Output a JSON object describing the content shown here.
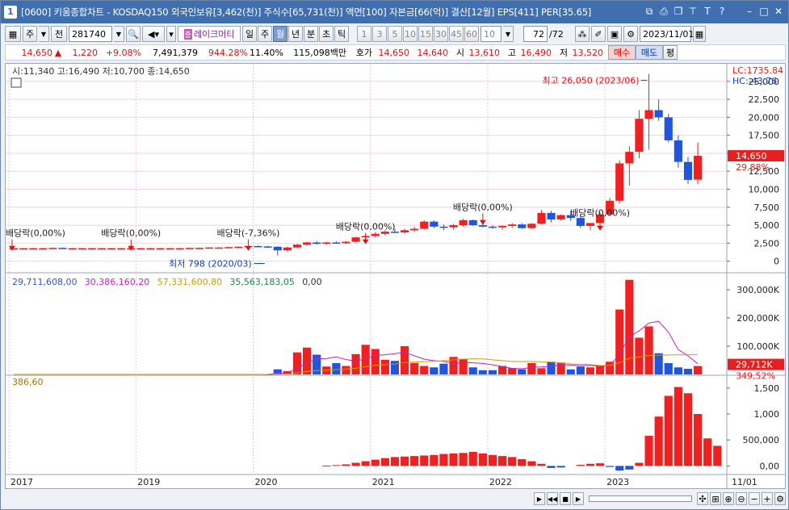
{
  "window": {
    "number": "1",
    "title": "[0600] 키움종합차트 - KOSDAQ150 외국인보유[3,462(천)] 주식수[65,731(천)] 액면[100] 자본금[66(억)] 결산[12월] EPS[411] PER[35.65]"
  },
  "toolbar": {
    "type_select": "주",
    "prefix_btn": "전",
    "code": "281740",
    "name": "레이크머티",
    "period": [
      "일",
      "주",
      "월",
      "년",
      "분",
      "초",
      "틱"
    ],
    "period_selected": "월",
    "intervals": [
      "1",
      "3",
      "5",
      "10",
      "15",
      "30",
      "45",
      "60"
    ],
    "interval_value": "10",
    "count": "72",
    "count_total": "/72",
    "date": "2023/11/01"
  },
  "quote": {
    "price": "14,650",
    "arrow": "▲",
    "change": "1,220",
    "rate": "+9.08%",
    "volume": "7,491,379",
    "vol_ratio": "944.28%",
    "turnover": "11.40%",
    "amount": "115,098백만",
    "ask_label": "호가",
    "ask": "14,650",
    "bid": "14,640",
    "open_label": "시",
    "open": "13,610",
    "high_label": "고",
    "high": "16,490",
    "low_label": "저",
    "low": "13,520",
    "buy_btn": "매수",
    "sell_btn": "매도",
    "avg_btn": "평"
  },
  "chart_data": [
    {
      "type": "candlestick",
      "panel": "price",
      "legend": "시:11,340 고:16,490 저:10,700 종:14,650",
      "y_ticks": [
        "0",
        "2,500",
        "5,000",
        "7,500",
        "10,000",
        "12,500",
        "15,000",
        "17,500",
        "20,000",
        "22,500",
        "25,000"
      ],
      "ylim": [
        -1500,
        27000
      ],
      "lc_label": "LC:1735.84",
      "hc_label": "HC:-43.76",
      "price_tag": "14,650",
      "pct_tag": "29.88%",
      "annotations": [
        {
          "text": "배당락(0,00%)",
          "month": 1,
          "price": 1900,
          "side": "left"
        },
        {
          "text": "배당락(0,00%)",
          "month": 13,
          "price": 1900
        },
        {
          "text": "배당락(-7,36%)",
          "month": 25,
          "price": 1900
        },
        {
          "text": "배당락(0,00%)",
          "month": 37,
          "price": 2800
        },
        {
          "text": "배당락(0,00%)",
          "month": 49,
          "price": 5500
        },
        {
          "text": "배당락(0,00%)",
          "month": 61,
          "price": 4700
        },
        {
          "text": "최고 26,050 (2023/06)",
          "month": 66,
          "price": 26050,
          "kind": "high"
        },
        {
          "text": "최저 798 (2020/03)",
          "month": 27,
          "price": 798,
          "kind": "low"
        }
      ],
      "candles": [
        [
          1800,
          1800,
          1800,
          1800
        ],
        [
          1800,
          1850,
          1750,
          1800
        ],
        [
          1800,
          1850,
          1750,
          1800
        ],
        [
          1800,
          1850,
          1750,
          1800
        ],
        [
          1800,
          1900,
          1750,
          1850
        ],
        [
          1850,
          1900,
          1800,
          1800
        ],
        [
          1800,
          1850,
          1750,
          1800
        ],
        [
          1800,
          1850,
          1750,
          1800
        ],
        [
          1800,
          1850,
          1750,
          1800
        ],
        [
          1800,
          1850,
          1750,
          1800
        ],
        [
          1800,
          1850,
          1750,
          1800
        ],
        [
          1800,
          1850,
          1750,
          1800
        ],
        [
          1800,
          1850,
          1750,
          1800
        ],
        [
          1800,
          1850,
          1750,
          1800
        ],
        [
          1800,
          1850,
          1750,
          1800
        ],
        [
          1800,
          1850,
          1750,
          1800
        ],
        [
          1800,
          1850,
          1750,
          1800
        ],
        [
          1800,
          1850,
          1750,
          1800
        ],
        [
          1800,
          1900,
          1750,
          1850
        ],
        [
          1850,
          1900,
          1800,
          1850
        ],
        [
          1850,
          1950,
          1800,
          1900
        ],
        [
          1900,
          1950,
          1850,
          1900
        ],
        [
          1900,
          2000,
          1850,
          1950
        ],
        [
          1950,
          2050,
          1900,
          2000
        ],
        [
          2000,
          2150,
          1950,
          2100
        ],
        [
          2100,
          2200,
          2000,
          2050
        ],
        [
          2050,
          2150,
          1900,
          2000
        ],
        [
          2000,
          2050,
          798,
          1500
        ],
        [
          1500,
          2000,
          1350,
          1900
        ],
        [
          1900,
          2400,
          1850,
          2300
        ],
        [
          2300,
          2700,
          2200,
          2600
        ],
        [
          2600,
          2800,
          2300,
          2400
        ],
        [
          2400,
          2700,
          2300,
          2600
        ],
        [
          2600,
          2750,
          2400,
          2500
        ],
        [
          2500,
          2800,
          2400,
          2700
        ],
        [
          2700,
          3400,
          2600,
          3300
        ],
        [
          3300,
          3700,
          3100,
          3500
        ],
        [
          3500,
          4000,
          3300,
          3800
        ],
        [
          3800,
          4300,
          3600,
          4100
        ],
        [
          4100,
          4500,
          3900,
          4000
        ],
        [
          4000,
          4500,
          3800,
          4300
        ],
        [
          4300,
          4800,
          4100,
          4500
        ],
        [
          4500,
          5700,
          4400,
          5500
        ],
        [
          5500,
          5700,
          4600,
          4800
        ],
        [
          4800,
          5100,
          4300,
          4700
        ],
        [
          4700,
          5200,
          4400,
          5000
        ],
        [
          5000,
          5900,
          4800,
          5700
        ],
        [
          5700,
          5800,
          4900,
          5000
        ],
        [
          5000,
          5200,
          4700,
          4800
        ],
        [
          4800,
          5000,
          4500,
          4700
        ],
        [
          4700,
          5000,
          4400,
          4900
        ],
        [
          4900,
          5300,
          4600,
          5100
        ],
        [
          5100,
          5300,
          4500,
          4600
        ],
        [
          4600,
          5300,
          4500,
          5200
        ],
        [
          5200,
          7100,
          5100,
          6700
        ],
        [
          6700,
          7000,
          5400,
          5800
        ],
        [
          5800,
          6500,
          5600,
          6400
        ],
        [
          6400,
          7000,
          5600,
          6000
        ],
        [
          6000,
          6300,
          4600,
          4900
        ],
        [
          4900,
          5300,
          4300,
          5300
        ],
        [
          5300,
          6800,
          5200,
          6500
        ],
        [
          6500,
          8800,
          6300,
          8400
        ],
        [
          8400,
          14000,
          8000,
          13600
        ],
        [
          13600,
          16000,
          10500,
          15200
        ],
        [
          15200,
          21000,
          14300,
          19800
        ],
        [
          19800,
          26050,
          15500,
          21000
        ],
        [
          21000,
          22500,
          19500,
          20000
        ],
        [
          20000,
          20500,
          16500,
          16800
        ],
        [
          16800,
          17500,
          13000,
          13800
        ],
        [
          13800,
          14500,
          10700,
          11300
        ],
        [
          11340,
          16490,
          10700,
          14650
        ]
      ],
      "axis_labels": [
        {
          "month": 0,
          "text": "2017"
        },
        {
          "month": 13,
          "text": "2019"
        },
        {
          "month": 25,
          "text": "2020"
        },
        {
          "month": 37,
          "text": "2021"
        },
        {
          "month": 49,
          "text": "2022"
        },
        {
          "month": 61,
          "text": "2023"
        },
        {
          "month": 75,
          "text": "11/01"
        }
      ]
    },
    {
      "type": "bar",
      "panel": "volume",
      "legend": [
        "29,711,608,00",
        "30,386,160,20",
        "57,331,600,80",
        "35,563,183,05",
        "0,00"
      ],
      "legend_colors": [
        "#3355cc",
        "#cc22cc",
        "#d49b00",
        "#1a8a3a",
        "#333333"
      ],
      "y_ticks": [
        "100,000K",
        "200,000K",
        "300,000K"
      ],
      "ylim": [
        0,
        340000
      ],
      "tag1": "29,712K",
      "tag2": "349,52%",
      "values": [
        0,
        0,
        0,
        0,
        0,
        0,
        0,
        0,
        0,
        0,
        0,
        0,
        0,
        0,
        0,
        0,
        0,
        0,
        0,
        0,
        0,
        0,
        0,
        0,
        0,
        0,
        1000,
        18000,
        12000,
        78000,
        95000,
        70000,
        28000,
        40000,
        30000,
        72000,
        105000,
        90000,
        52000,
        48000,
        100000,
        40000,
        30000,
        25000,
        38000,
        62000,
        55000,
        25000,
        15000,
        15000,
        30000,
        22000,
        18000,
        40000,
        22000,
        45000,
        42000,
        18000,
        28000,
        25000,
        32000,
        45000,
        230000,
        335000,
        130000,
        170000,
        75000,
        40000,
        25000,
        20000,
        29712
      ]
    },
    {
      "type": "bar",
      "panel": "indicator",
      "legend": "386,60",
      "y_ticks": [
        "0,00",
        "500,000",
        "1,000",
        "1,500"
      ],
      "ylim": [
        -150,
        1700
      ],
      "values": [
        0,
        0,
        0,
        0,
        0,
        0,
        0,
        0,
        0,
        0,
        0,
        0,
        0,
        0,
        0,
        0,
        0,
        0,
        0,
        0,
        0,
        0,
        0,
        0,
        0,
        0,
        0,
        0,
        0,
        0,
        0,
        0,
        5,
        15,
        30,
        60,
        90,
        120,
        150,
        170,
        180,
        190,
        200,
        210,
        230,
        240,
        250,
        270,
        240,
        210,
        190,
        170,
        130,
        90,
        40,
        -40,
        -30,
        0,
        20,
        40,
        50,
        -20,
        -90,
        -70,
        60,
        580,
        950,
        1350,
        1520,
        1400,
        1000,
        530,
        386.6
      ]
    }
  ],
  "bottom": {
    "zoom_minus": "−",
    "zoom_plus": "+"
  }
}
